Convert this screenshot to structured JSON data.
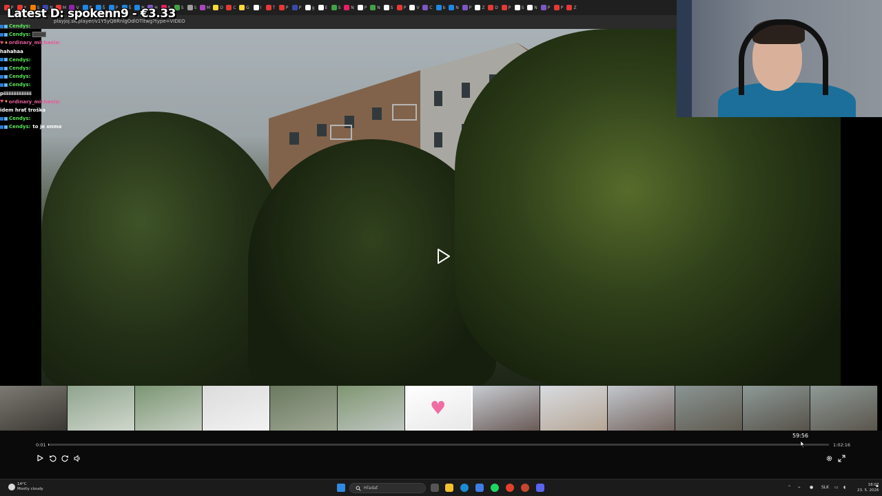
{
  "overlay": {
    "donation_banner": "Latest D: spokenn9 - €3.33"
  },
  "browser": {
    "url": "playjoj.sk/player/v1Y5yQ8RnlgOdlOTltwg?type=VIDEO",
    "tabs": [
      {
        "label": "P",
        "color": "#e53935"
      },
      {
        "label": "Y",
        "color": "#e53935"
      },
      {
        "label": "S",
        "color": "#f57c00"
      },
      {
        "label": "N",
        "color": "#3949ab"
      },
      {
        "label": "M",
        "color": "#e53935"
      },
      {
        "label": "V",
        "color": "#8e24aa"
      },
      {
        "label": "P",
        "color": "#1e88e5"
      },
      {
        "label": "Š",
        "color": "#1e88e5"
      },
      {
        "label": "P",
        "color": "#1e88e5"
      },
      {
        "label": "Š",
        "color": "#1e88e5"
      },
      {
        "label": "N",
        "color": "#1e88e5"
      },
      {
        "label": "H",
        "color": "#7e57c2"
      },
      {
        "label": "S",
        "color": "#e91e63"
      },
      {
        "label": "S",
        "color": "#43a047"
      },
      {
        "label": "S",
        "color": "#9e9e9e"
      },
      {
        "label": "M",
        "color": "#ab47bc"
      },
      {
        "label": "D",
        "color": "#fdd835"
      },
      {
        "label": "C",
        "color": "#e53935"
      },
      {
        "label": "G",
        "color": "#fdd835"
      },
      {
        "label": "I",
        "color": "#ffffff"
      },
      {
        "label": "T",
        "color": "#e53935"
      },
      {
        "label": "P",
        "color": "#e53935"
      },
      {
        "label": "P",
        "color": "#3949ab"
      },
      {
        "label": "g",
        "color": "#ffffff"
      },
      {
        "label": "E",
        "color": "#ffffff"
      },
      {
        "label": "S",
        "color": "#43a047"
      },
      {
        "label": "N",
        "color": "#e91e63"
      },
      {
        "label": "P",
        "color": "#ffffff"
      },
      {
        "label": "N",
        "color": "#43a047"
      },
      {
        "label": "S",
        "color": "#ffffff"
      },
      {
        "label": "P",
        "color": "#e53935"
      },
      {
        "label": "V",
        "color": "#ffffff"
      },
      {
        "label": "C",
        "color": "#7e57c2"
      },
      {
        "label": "b",
        "color": "#1e88e5"
      },
      {
        "label": "N",
        "color": "#1e88e5"
      },
      {
        "label": "P",
        "color": "#7e57c2"
      },
      {
        "label": "Z",
        "color": "#ffffff"
      },
      {
        "label": "D",
        "color": "#e53935"
      },
      {
        "label": "P",
        "color": "#e53935"
      },
      {
        "label": "S",
        "color": "#ffffff"
      },
      {
        "label": "N",
        "color": "#ffffff"
      },
      {
        "label": "P",
        "color": "#7e57c2"
      },
      {
        "label": "P",
        "color": "#e53935"
      },
      {
        "label": "Z",
        "color": "#e53935"
      }
    ]
  },
  "chat": [
    {
      "user": "Cendys:",
      "user_color": "#5ae85a",
      "message": "",
      "style": "normal"
    },
    {
      "user": "Cendys:",
      "user_color": "#5ae85a",
      "message": "",
      "style": "emote"
    },
    {
      "user": "ordinary_michaela:",
      "user_color": "#e35d9a",
      "message": "hahahaa",
      "style": "twoline"
    },
    {
      "user": "Cendys:",
      "user_color": "#5ae85a",
      "message": "",
      "style": "normal"
    },
    {
      "user": "Cendys:",
      "user_color": "#5ae85a",
      "message": "",
      "style": "normal"
    },
    {
      "user": "Cendys:",
      "user_color": "#5ae85a",
      "message": "",
      "style": "normal"
    },
    {
      "user": "Cendys:",
      "user_color": "#5ae85a",
      "message": "piiiiiiiiiiiiiiiii",
      "style": "wrapped"
    },
    {
      "user": "ordinary_michaela:",
      "user_color": "#e35d9a",
      "message": "idem hrať troška",
      "style": "twoline"
    },
    {
      "user": "Cendys:",
      "user_color": "#5ae85a",
      "message": "",
      "style": "normal"
    },
    {
      "user": "Cendys:",
      "user_color": "#5ae85a",
      "message": "to je onmo",
      "style": "normal"
    }
  ],
  "player": {
    "current_time": "0:01",
    "duration": "1:02:16",
    "hover_time": "59:56",
    "progress_fraction": 0.0003,
    "thumbnails": [
      {
        "scene": "woman-closeup",
        "colors": [
          "#7c7a73",
          "#3b3833"
        ]
      },
      {
        "scene": "outdoor-table",
        "colors": [
          "#8fa48e",
          "#cfd7cc"
        ]
      },
      {
        "scene": "outdoor-table",
        "colors": [
          "#7b9673",
          "#c7cfc3"
        ]
      },
      {
        "scene": "bright-haze",
        "colors": [
          "#dcdcdc",
          "#f2f2f2"
        ]
      },
      {
        "scene": "woman-garden",
        "colors": [
          "#6b7a60",
          "#9fa795"
        ]
      },
      {
        "scene": "picnic",
        "colors": [
          "#7f9671",
          "#bfc6c1"
        ]
      },
      {
        "scene": "heart-logo",
        "colors": [
          "#ffffff",
          "#e8e8e8"
        ],
        "active": true
      },
      {
        "scene": "group-indoor",
        "colors": [
          "#c7ccd2",
          "#6a5a56"
        ]
      },
      {
        "scene": "man-smiling",
        "colors": [
          "#d8dbe0",
          "#b6a696"
        ]
      },
      {
        "scene": "group-indoor",
        "colors": [
          "#c2c7cd",
          "#756660"
        ]
      },
      {
        "scene": "sofa-group",
        "colors": [
          "#8a9594",
          "#5f5a4f"
        ]
      },
      {
        "scene": "sofa-group",
        "colors": [
          "#8d9a97",
          "#57524a"
        ]
      },
      {
        "scene": "sofa-group",
        "colors": [
          "#8f9a96",
          "#5a554d"
        ]
      }
    ]
  },
  "taskbar": {
    "weather_temp": "14°C",
    "weather_desc": "Mostly cloudy",
    "search_placeholder": "Hľadať",
    "language": "SLK",
    "time": "18:07",
    "date": "23. 5. 2026"
  }
}
